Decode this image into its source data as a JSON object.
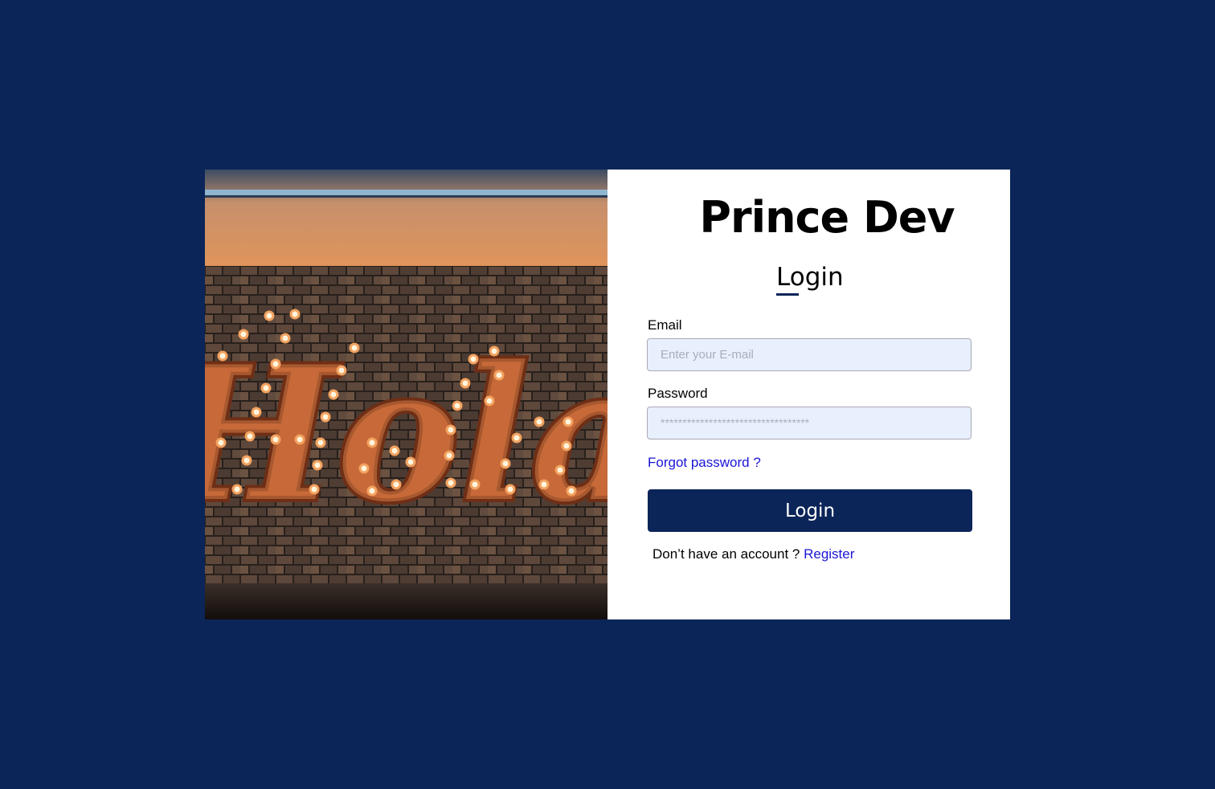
{
  "brand": {
    "title": "Prince Dev"
  },
  "form": {
    "heading": "Login",
    "email_label": "Email",
    "email_placeholder": "Enter your E-mail",
    "email_value": "",
    "password_label": "Password",
    "password_placeholder": "**********************************",
    "password_value": "",
    "forgot_label": "Forgot password ?",
    "submit_label": "Login",
    "signup_prompt": "Don’t have an account ?",
    "register_label": "Register"
  },
  "hero": {
    "sign_text": "Hola"
  },
  "colors": {
    "background": "#0b2559",
    "card": "#ffffff",
    "input_fill": "#e8effd",
    "link": "#1a14d6",
    "button": "#0b2559"
  }
}
